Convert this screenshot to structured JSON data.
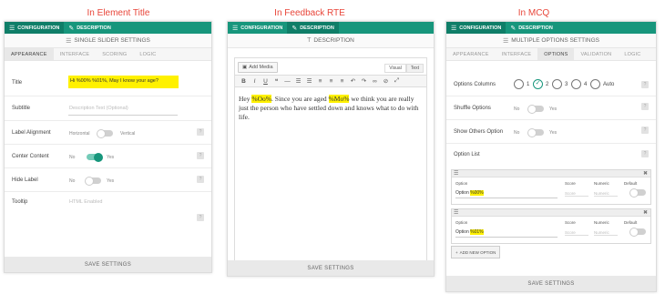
{
  "captions": {
    "left": "In Element Title",
    "middle": "In Feedback RTE",
    "right": "In MCQ"
  },
  "topbar": {
    "configuration": "CONFIGURATION",
    "description": "DESCRIPTION"
  },
  "left_panel": {
    "heading": "SINGLE SLIDER SETTINGS",
    "tabs": [
      "APPEARANCE",
      "INTERFACE",
      "SCORING",
      "LOGIC"
    ],
    "title_label": "Title",
    "title_value": "Hi %00% %01%, May I know your age?",
    "subtitle_label": "Subtitle",
    "subtitle_placeholder": "Description Text (Optional)",
    "label_alignment_label": "Label Alignment",
    "horizontal": "Horizontal",
    "vertical": "Vertical",
    "center_content_label": "Center Content",
    "hide_label_label": "Hide Label",
    "no": "No",
    "yes": "Yes",
    "tooltip_label": "Tooltip",
    "tooltip_placeholder": "HTML Enabled",
    "save": "SAVE SETTINGS"
  },
  "middle_panel": {
    "heading": "DESCRIPTION",
    "add_media": "Add Media",
    "visual": "Visual",
    "text": "Text",
    "content_pre1": "Hey ",
    "content_var1": "%Oo%",
    "content_mid": ". Since you are aged ",
    "content_var2": "%Mo%",
    "content_post": " we think you are really just the person who have settled down and knows what to do with life.",
    "save": "SAVE SETTINGS"
  },
  "right_panel": {
    "heading": "MULTIPLE OPTIONS SETTINGS",
    "tabs": [
      "APPEARANCE",
      "INTERFACE",
      "OPTIONS",
      "VALIDATION",
      "LOGIC"
    ],
    "options_columns_label": "Options Columns",
    "columns": [
      "1",
      "2",
      "3",
      "4",
      "Auto"
    ],
    "shuffle_label": "Shuffle Options",
    "show_others_label": "Show Others Option",
    "no": "No",
    "yes": "Yes",
    "option_list_label": "Option List",
    "col_option": "Option",
    "col_score": "Score",
    "col_numeric": "Numeric",
    "col_default": "Default",
    "opt_prefix": "Option ",
    "opt1_var": "%00%",
    "opt2_var": "%01%",
    "score_ph": "Score",
    "numeric_ph": "Numeric",
    "add_option": "ADD NEW OPTION",
    "save": "SAVE SETTINGS"
  },
  "colors": {
    "accent": "#17967c",
    "caption": "#e8463a",
    "highlight": "#fff100"
  }
}
